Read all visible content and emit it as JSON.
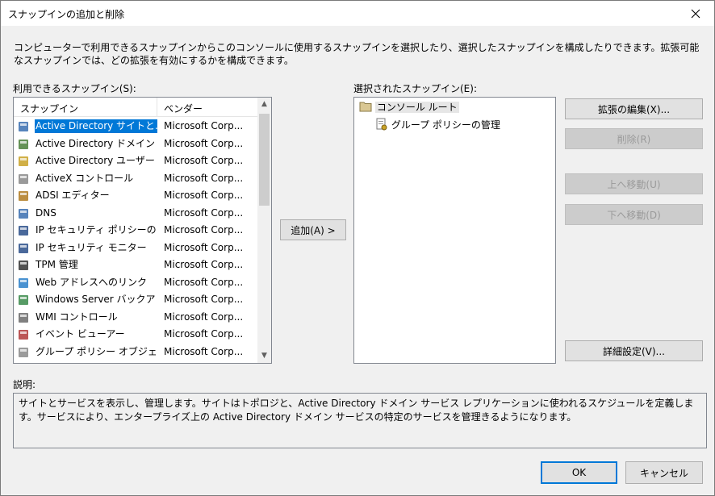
{
  "window": {
    "title": "スナップインの追加と削除"
  },
  "intro_text": "コンピューターで利用できるスナップインからこのコンソールに使用するスナップインを選択したり、選択したスナップインを構成したりできます。拡張可能なスナップインでは、どの拡張を有効にするかを構成できます。",
  "available": {
    "label": "利用できるスナップイン(S):",
    "col_snapin": "スナップイン",
    "col_vendor": "ベンダー",
    "items": [
      {
        "name": "Active Directory サイトと...",
        "vendor": "Microsoft Corp...",
        "icon": "ad-sites-icon"
      },
      {
        "name": "Active Directory ドメイン...",
        "vendor": "Microsoft Corp...",
        "icon": "ad-domains-icon"
      },
      {
        "name": "Active Directory ユーザー...",
        "vendor": "Microsoft Corp...",
        "icon": "ad-users-icon"
      },
      {
        "name": "ActiveX コントロール",
        "vendor": "Microsoft Corp...",
        "icon": "activex-icon"
      },
      {
        "name": "ADSI エディター",
        "vendor": "Microsoft Corp...",
        "icon": "adsi-edit-icon"
      },
      {
        "name": "DNS",
        "vendor": "Microsoft Corp...",
        "icon": "dns-icon"
      },
      {
        "name": "IP セキュリティ ポリシーの管...",
        "vendor": "Microsoft Corp...",
        "icon": "ipsec-policy-icon"
      },
      {
        "name": "IP セキュリティ モニター",
        "vendor": "Microsoft Corp...",
        "icon": "ipsec-monitor-icon"
      },
      {
        "name": "TPM 管理",
        "vendor": "Microsoft Corp...",
        "icon": "tpm-icon"
      },
      {
        "name": "Web アドレスへのリンク",
        "vendor": "Microsoft Corp...",
        "icon": "web-link-icon"
      },
      {
        "name": "Windows Server バックア...",
        "vendor": "Microsoft Corp...",
        "icon": "backup-icon"
      },
      {
        "name": "WMI コントロール",
        "vendor": "Microsoft Corp...",
        "icon": "wmi-icon"
      },
      {
        "name": "イベント ビューアー",
        "vendor": "Microsoft Corp...",
        "icon": "event-viewer-icon"
      },
      {
        "name": "グループ ポリシー オブジェク...",
        "vendor": "Microsoft Corp...",
        "icon": "gpo-icon"
      }
    ]
  },
  "add_button": "追加(A) >",
  "selected": {
    "label": "選択されたスナップイン(E):",
    "root": "コンソール ルート",
    "child": "グループ ポリシーの管理"
  },
  "buttons": {
    "edit_extensions": "拡張の編集(X)...",
    "remove": "削除(R)",
    "move_up": "上へ移動(U)",
    "move_down": "下へ移動(D)",
    "advanced": "詳細設定(V)...",
    "ok": "OK",
    "cancel": "キャンセル"
  },
  "description": {
    "label": "説明:",
    "text": "サイトとサービスを表示し、管理します。サイトはトポロジと、Active Directory ドメイン サービス レプリケーションに使われるスケジュールを定義します。サービスにより、エンタープライズ上の Active Directory ドメイン サービスの特定のサービスを管理きるようになります。"
  },
  "colors": {
    "selection": "#0078d7",
    "background": "#f0f0f0"
  }
}
